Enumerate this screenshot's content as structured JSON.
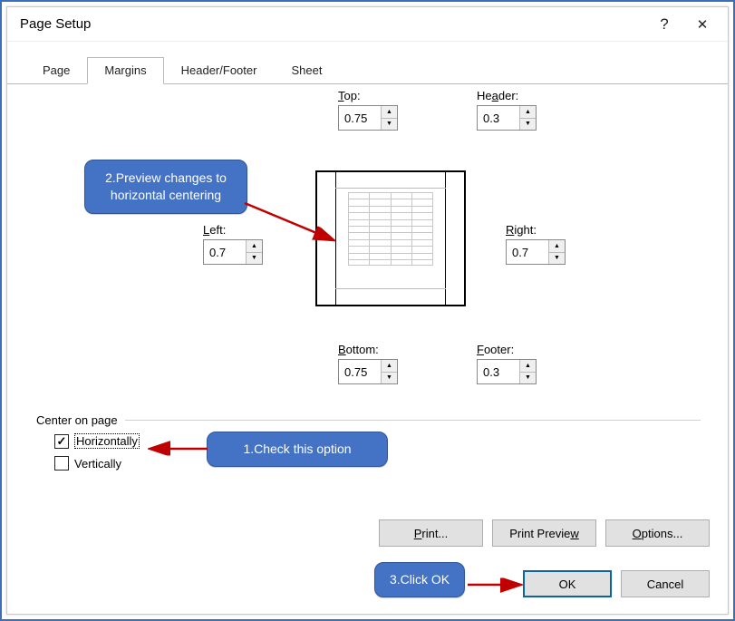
{
  "dialog": {
    "title": "Page Setup",
    "help_symbol": "?",
    "close_symbol": "✕"
  },
  "tabs": {
    "items": [
      {
        "label": "Page"
      },
      {
        "label": "Margins"
      },
      {
        "label": "Header/Footer"
      },
      {
        "label": "Sheet"
      }
    ],
    "active_index": 1
  },
  "margins": {
    "top": {
      "label_pre": "",
      "label_u": "T",
      "label_post": "op:",
      "value": "0.75"
    },
    "header": {
      "label_pre": "He",
      "label_u": "a",
      "label_post": "der:",
      "value": "0.3"
    },
    "left": {
      "label_pre": "",
      "label_u": "L",
      "label_post": "eft:",
      "value": "0.7"
    },
    "right": {
      "label_pre": "",
      "label_u": "R",
      "label_post": "ight:",
      "value": "0.7"
    },
    "bottom": {
      "label_pre": "",
      "label_u": "B",
      "label_post": "ottom:",
      "value": "0.75"
    },
    "footer": {
      "label_pre": "",
      "label_u": "F",
      "label_post": "ooter:",
      "value": "0.3"
    }
  },
  "center_group": {
    "legend": "Center on page",
    "horizontally": {
      "pre": "Hori",
      "u": "z",
      "post": "ontally",
      "checked": true
    },
    "vertically": {
      "pre": "",
      "u": "V",
      "post": "ertically",
      "checked": false
    }
  },
  "buttons": {
    "print": {
      "pre": "",
      "u": "P",
      "post": "rint..."
    },
    "preview": {
      "pre": "Print Previe",
      "u": "w",
      "post": ""
    },
    "options": {
      "pre": "",
      "u": "O",
      "post": "ptions..."
    },
    "ok": "OK",
    "cancel": "Cancel"
  },
  "callouts": {
    "c1": "2.Preview changes to horizontal centering",
    "c2": "1.Check this option",
    "c3": "3.Click OK"
  }
}
